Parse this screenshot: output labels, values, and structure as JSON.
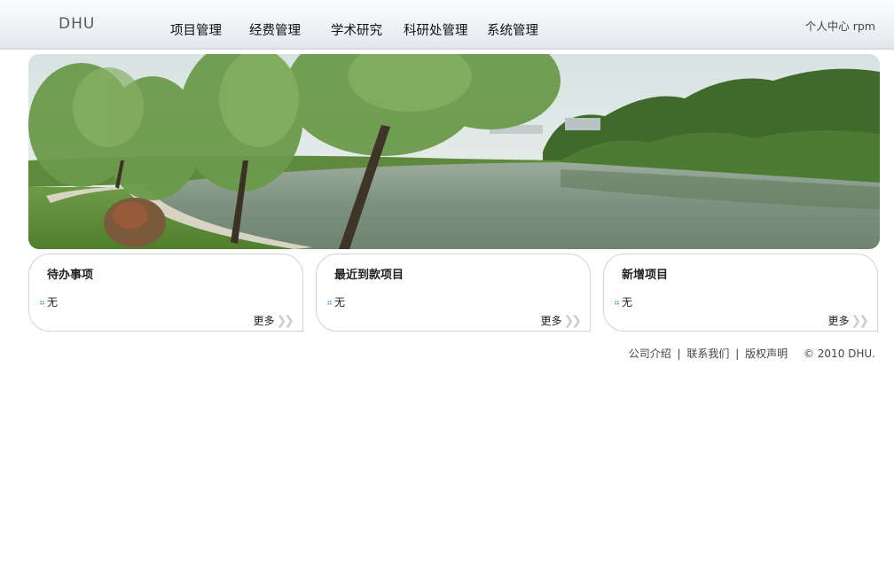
{
  "header": {
    "logo": "DHU",
    "nav": [
      "项目管理",
      "经费管理",
      "学术研究",
      "科研处管理",
      "系统管理"
    ],
    "personal_center": "个人中心",
    "username": "rpm"
  },
  "panels": [
    {
      "title": "待办事项",
      "items": [
        "无"
      ],
      "more": "更多"
    },
    {
      "title": "最近到款项目",
      "items": [
        "无"
      ],
      "more": "更多"
    },
    {
      "title": "新增项目",
      "items": [
        "无"
      ],
      "more": "更多"
    }
  ],
  "footer": {
    "links": [
      "公司介绍",
      "联系我们",
      "版权声明"
    ],
    "separator": "|",
    "copyright": "© 2010 DHU."
  },
  "colors": {
    "bullet": "#2a9fc3",
    "header_bg": "#eef1f4"
  }
}
